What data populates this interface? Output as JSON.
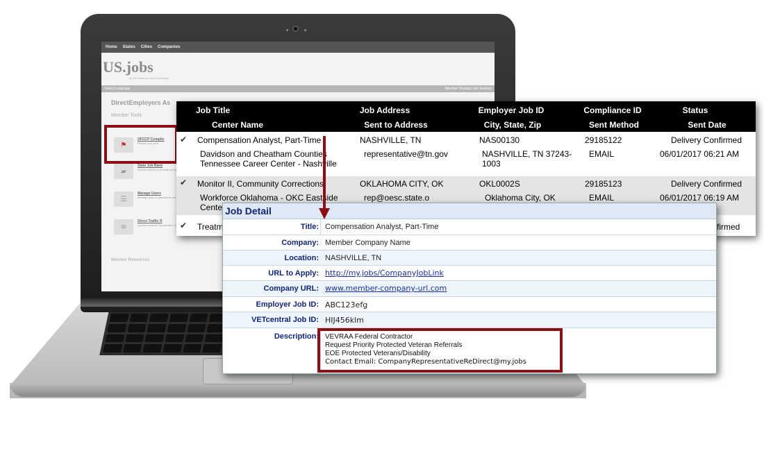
{
  "site": {
    "nav": [
      "Home",
      "States",
      "Cities",
      "Companies"
    ],
    "logo": "US.jobs",
    "logo_sub": "by the National Labor Exchange",
    "lang": "Select Language",
    "lang_right": "Member Desktop  Job Seekers",
    "member_title": "DirectEmployers As",
    "tools_label": "Member Tools",
    "tools": [
      {
        "title": "OFCCP Complic",
        "desc": "Review and print",
        "icon": "shield-badge-icon"
      },
      {
        "title": "State Job Bank",
        "desc": "Access reports a on state job ban",
        "icon": "us-map-icon"
      },
      {
        "title": "Manage Users",
        "desc": "Manage your co passwords and",
        "icon": "people-icon"
      },
      {
        "title": "Direct Traffic R",
        "desc": "Access measure Syndicated Job",
        "icon": "traffic-icon"
      }
    ],
    "resources": "Member Resources"
  },
  "report": {
    "headers_top": [
      "Job Title",
      "Job Address",
      "Employer Job ID",
      "Compliance ID",
      "Status"
    ],
    "headers_bottom": [
      "Center Name",
      "Sent to Address",
      "City, State, Zip",
      "Sent Method",
      "Sent Date"
    ],
    "rows": [
      {
        "title": "Compensation Analyst, Part-Time",
        "address": "NASHVILLE, TN",
        "employer_id": "NAS00130",
        "compliance_id": "29185122",
        "status": "Delivery Confirmed",
        "center": "Davidson and Cheatham Counties Tennessee Career Center - Nashville",
        "sent_to": "representative@tn.gov",
        "city": "NASHVILLE, TN 37243-1003",
        "method": "EMAIL",
        "date": "06/01/2017 06:21 AM"
      },
      {
        "title": "Monitor II, Community Corrections",
        "address": "OKLAHOMA CITY, OK",
        "employer_id": "OKL0002S",
        "compliance_id": "29185123",
        "status": "Delivery Confirmed",
        "center": "Workforce Oklahoma - OKC Eastside Cente",
        "sent_to": "rep@oesc.state.o",
        "city": "Oklahoma City, OK",
        "method": "EMAIL",
        "date": "06/01/2017 06:19 AM"
      },
      {
        "title": "Treatm",
        "status": "firmed"
      }
    ]
  },
  "detail": {
    "heading": "Job Detail",
    "fields": [
      {
        "label": "Title:",
        "value": "Compensation Analyst, Part-Time"
      },
      {
        "label": "Company:",
        "value": "Member Company Name"
      },
      {
        "label": "Location:",
        "value": "NASHVILLE, TN"
      },
      {
        "label": "URL to Apply:",
        "value": "http://my.jobs/CompanyJobLink"
      },
      {
        "label": "Company URL:",
        "value": "www.member-company-url.com"
      },
      {
        "label": "Employer Job ID:",
        "value": "ABC123efg"
      },
      {
        "label": "VETcentral Job ID:",
        "value": "HIJ456klm"
      }
    ],
    "description_label": "Description:",
    "description": [
      "VEVRAA Federal Contractor",
      "Request Priority Protected Veteran Referrals",
      "EOE Protected Veterans/Disability",
      "Contact Email:  CompanyRepresentativeReDirect@my.jobs"
    ]
  },
  "colors": {
    "highlight": "#8b0f14",
    "detail_label": "#10257a",
    "link": "#1a2fa0"
  }
}
